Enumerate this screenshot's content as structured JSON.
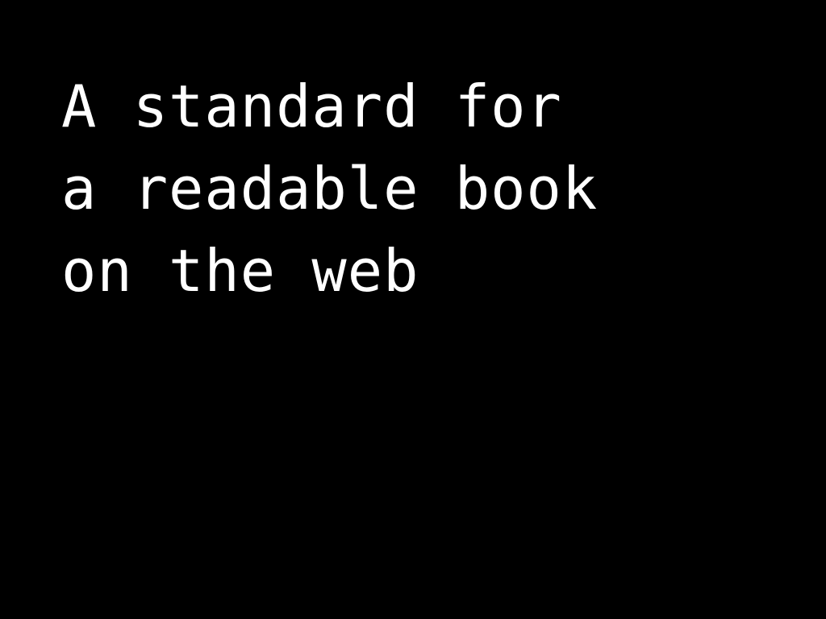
{
  "headline": {
    "lines": [
      "A standard for",
      "a readable book",
      "on the web"
    ]
  },
  "colors": {
    "background": "#000000",
    "text": "#ffffff"
  }
}
